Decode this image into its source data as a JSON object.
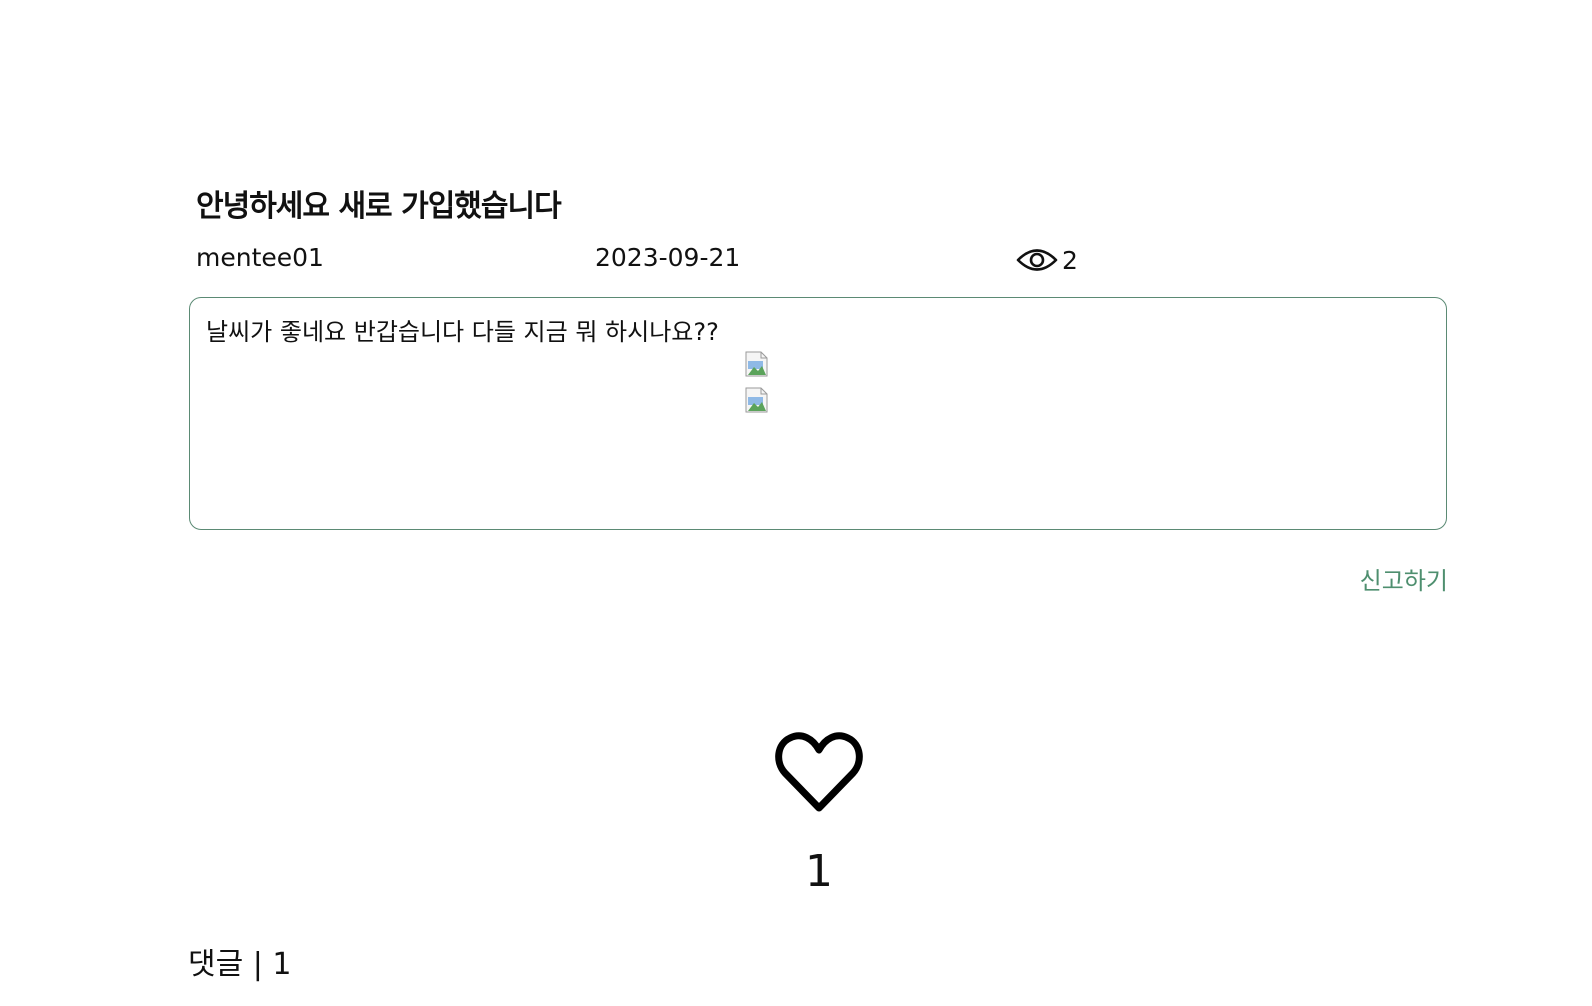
{
  "post": {
    "title": "안녕하세요 새로 가입했습니다",
    "author": "mentee01",
    "date": "2023-09-21",
    "views": "2",
    "views_icon": "eye-icon",
    "content": "날씨가 좋네요 반갑습니다 다들 지금 뭐 하시나요??"
  },
  "actions": {
    "report_label": "신고하기"
  },
  "likes": {
    "icon": "heart-outline-icon",
    "count": "1"
  },
  "comments": {
    "header": "댓글 | 1"
  },
  "colors": {
    "accent": "#4e8f6f",
    "border": "#5b8a74",
    "text": "#111111"
  }
}
